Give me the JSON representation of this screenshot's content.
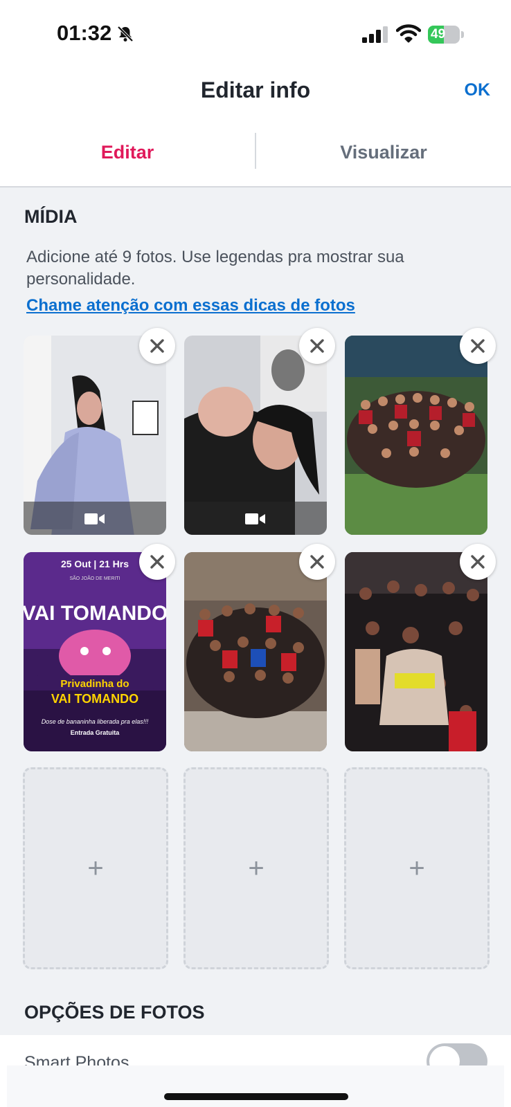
{
  "status_bar": {
    "time": "01:32",
    "battery_level": 49,
    "battery_label": "49"
  },
  "header": {
    "title": "Editar info",
    "ok_label": "OK"
  },
  "tabs": {
    "edit": "Editar",
    "preview": "Visualizar"
  },
  "media": {
    "title": "MÍDIA",
    "description": "Adicione até 9 fotos. Use legendas pra mostrar sua personalidade.",
    "tips_link": "Chame atenção com essas dicas de fotos",
    "photos": [
      {
        "kind": "video"
      },
      {
        "kind": "video"
      },
      {
        "kind": "photo"
      },
      {
        "kind": "photo",
        "poster_lines": [
          "25 Out | 21 Hrs",
          "SÃO JOÃO DE MERITI",
          "VAI TOMANDO",
          "Privadinha do",
          "VAI TOMANDO",
          "Dose de bananinha liberada pra elas!!!",
          "Entrada Gratuita"
        ]
      },
      {
        "kind": "photo"
      },
      {
        "kind": "photo"
      }
    ],
    "empty_slot_label": "+"
  },
  "photo_options": {
    "title": "OPÇÕES DE FOTOS",
    "smart_photos_label": "Smart Photos",
    "smart_photos_enabled": false
  },
  "colors": {
    "accent": "#e0195a",
    "link": "#0b6fcf",
    "background": "#f0f2f5"
  },
  "icons": [
    "bell-slash-icon",
    "signal-icon",
    "wifi-icon",
    "battery-icon",
    "close-icon",
    "video-camera-icon",
    "plus-icon"
  ]
}
